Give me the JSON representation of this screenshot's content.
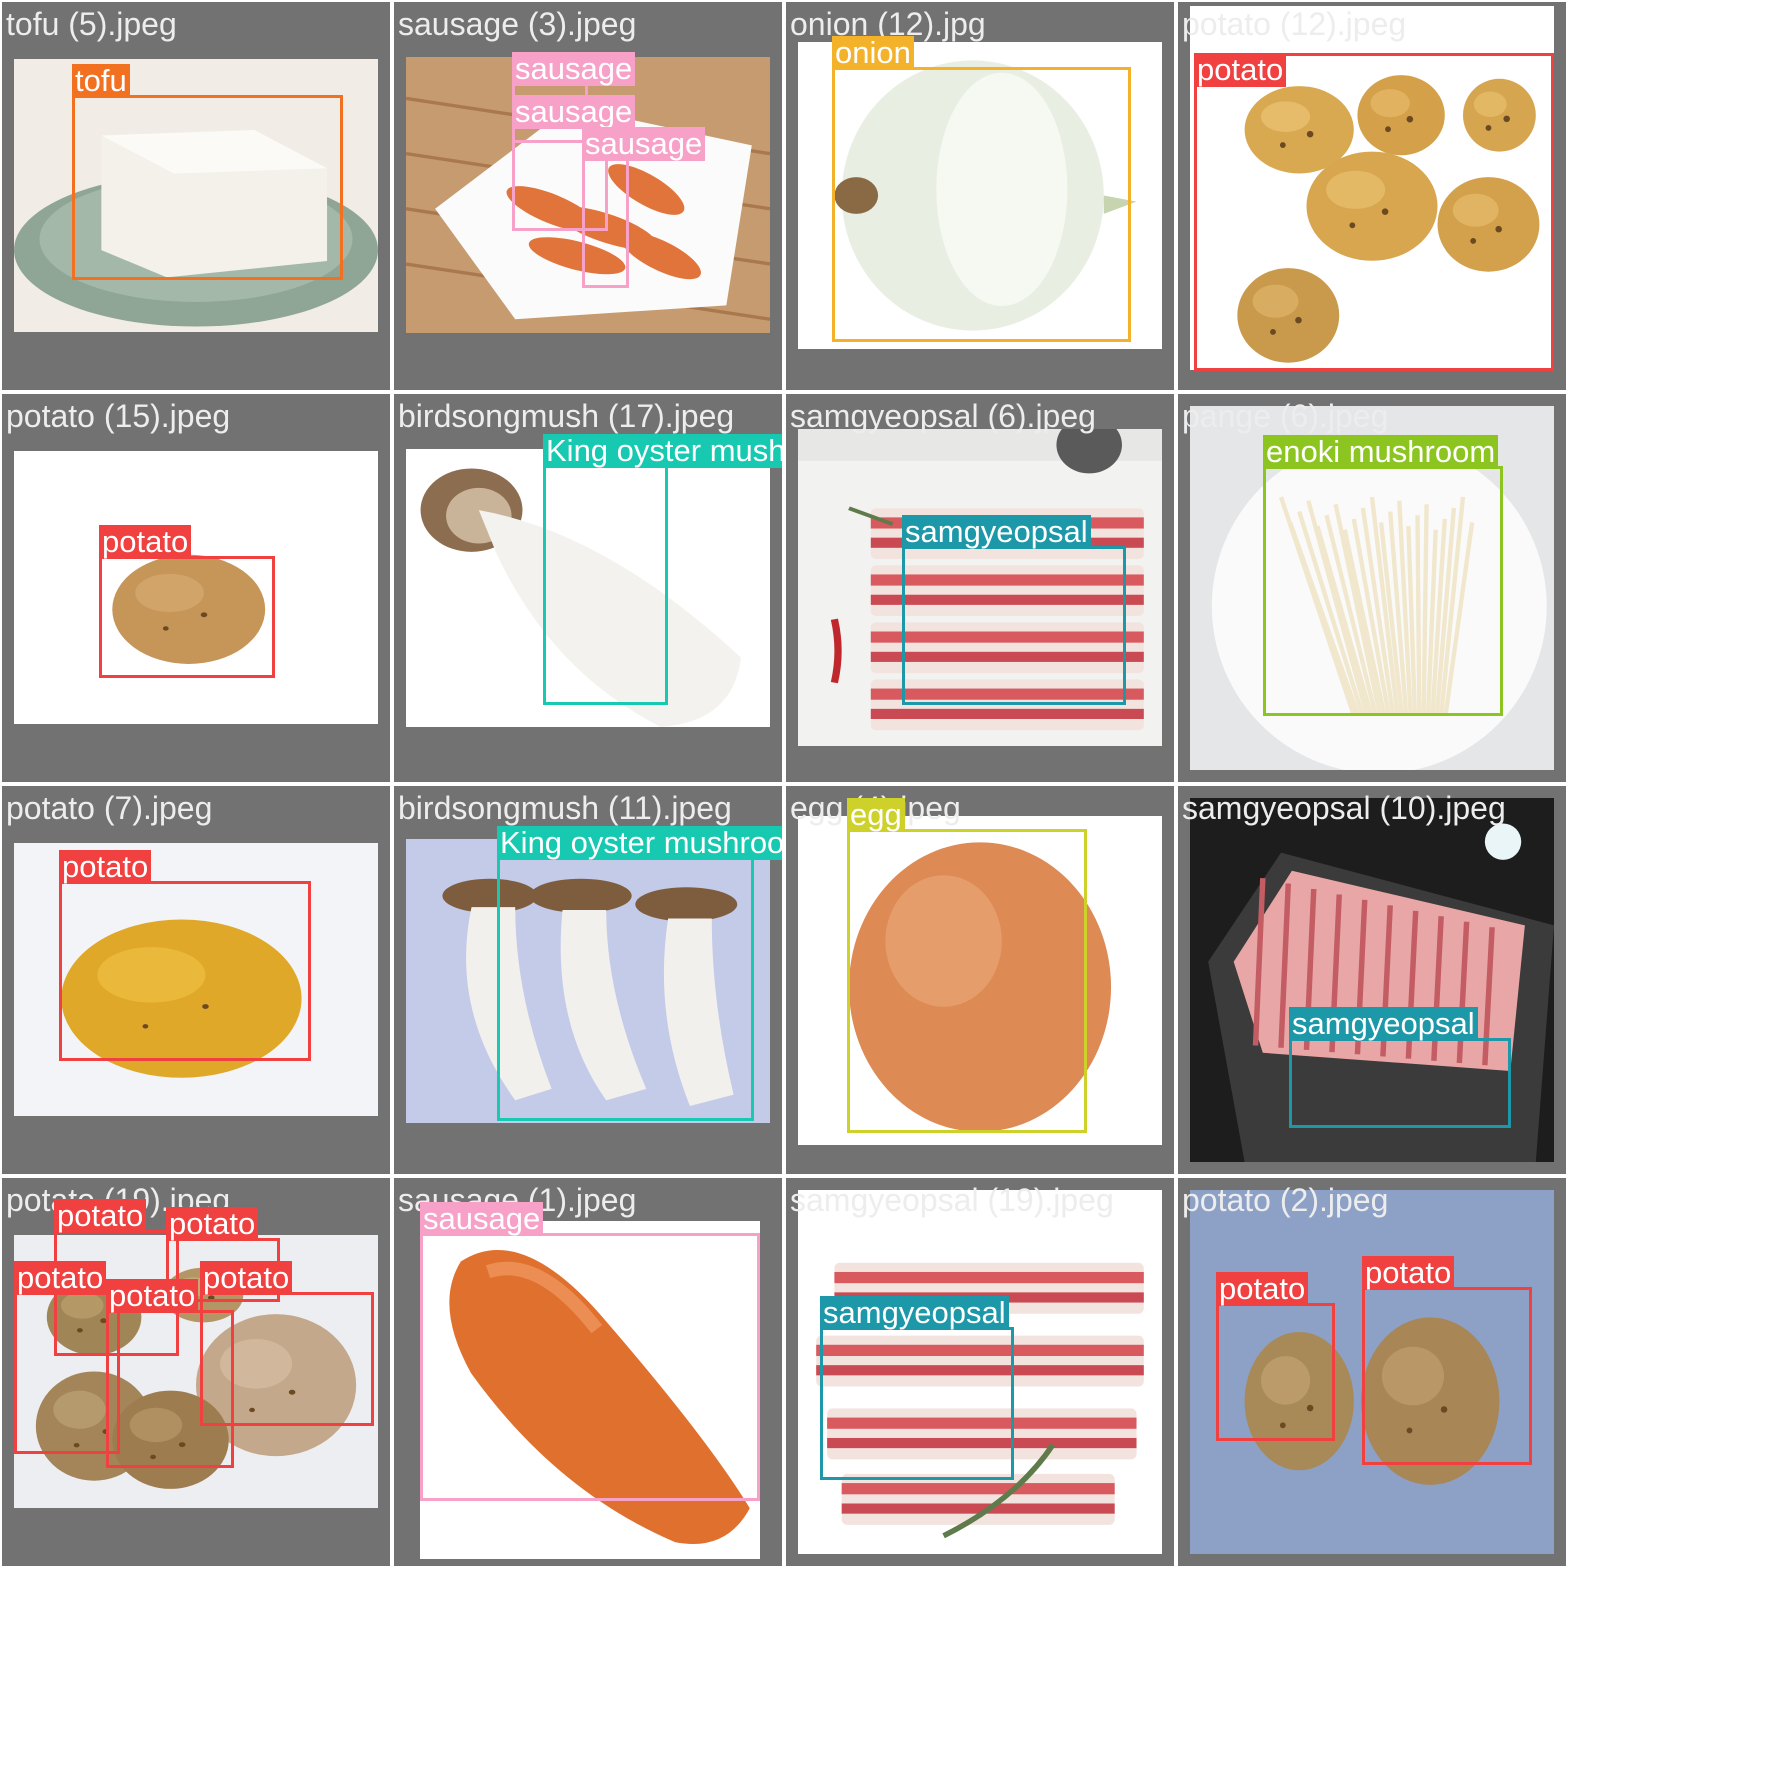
{
  "colors": {
    "tofu": "#f27121",
    "sausage": "#f7a1c8",
    "onion": "#f3b229",
    "potato": "#f04040",
    "king_oyster": "#17c9b0",
    "samgyeopsal": "#1d98a8",
    "enoki": "#8cc51f",
    "egg": "#cdd12a",
    "cell_bg": "#727272"
  },
  "cells": [
    {
      "title": "tofu (5).jpeg",
      "image": "tofu-image",
      "detections": [
        {
          "label": "tofu",
          "class": "tofu"
        }
      ]
    },
    {
      "title": "sausage (3).jpeg",
      "image": "sausage-plate-image",
      "detections": [
        {
          "label": "sausage",
          "class": "sausage"
        },
        {
          "label": "sausage",
          "class": "sausage"
        },
        {
          "label": "sausage",
          "class": "sausage"
        }
      ]
    },
    {
      "title": "onion (12).jpg",
      "image": "onion-image",
      "detections": [
        {
          "label": "onion",
          "class": "onion"
        }
      ]
    },
    {
      "title": "potato (12).jpeg",
      "image": "potatoes-pile-image",
      "detections": [
        {
          "label": "potato",
          "class": "potato"
        }
      ]
    },
    {
      "title": "potato (15).jpeg",
      "image": "single-potato-image",
      "detections": [
        {
          "label": "potato",
          "class": "potato"
        }
      ]
    },
    {
      "title": "birdsongmush (17).jpeg",
      "image": "king-oyster-mushroom-image",
      "detections": [
        {
          "label": "King oyster mushroom",
          "class": "king_oyster"
        }
      ]
    },
    {
      "title": "samgyeopsal (6).jpeg",
      "image": "pork-belly-tray-image",
      "detections": [
        {
          "label": "samgyeopsal",
          "class": "samgyeopsal"
        }
      ]
    },
    {
      "title": "pange (6).jpeg",
      "image": "enoki-mushroom-image",
      "detections": [
        {
          "label": "enoki mushroom",
          "class": "enoki"
        }
      ]
    },
    {
      "title": "potato (7).jpeg",
      "image": "yellow-potato-image",
      "detections": [
        {
          "label": "potato",
          "class": "potato"
        }
      ]
    },
    {
      "title": "birdsongmush (11).jpeg",
      "image": "three-mushrooms-image",
      "detections": [
        {
          "label": "King oyster mushroom",
          "class": "king_oyster"
        }
      ]
    },
    {
      "title": "egg (4).jpeg",
      "image": "egg-image",
      "detections": [
        {
          "label": "egg",
          "class": "egg"
        }
      ]
    },
    {
      "title": "samgyeopsal (10).jpeg",
      "image": "pork-belly-slate-image",
      "detections": [
        {
          "label": "samgyeopsal",
          "class": "samgyeopsal"
        }
      ]
    },
    {
      "title": "potato (19).jpeg",
      "image": "dirty-potatoes-image",
      "detections": [
        {
          "label": "potato",
          "class": "potato"
        },
        {
          "label": "potato",
          "class": "potato"
        },
        {
          "label": "potato",
          "class": "potato"
        },
        {
          "label": "potato",
          "class": "potato"
        },
        {
          "label": "potato",
          "class": "potato"
        }
      ]
    },
    {
      "title": "sausage (1).jpeg",
      "image": "large-sausage-image",
      "detections": [
        {
          "label": "sausage",
          "class": "sausage"
        }
      ]
    },
    {
      "title": "samgyeopsal (19).jpeg",
      "image": "pork-belly-rosemary-image",
      "detections": [
        {
          "label": "samgyeopsal",
          "class": "samgyeopsal"
        }
      ]
    },
    {
      "title": "potato (2).jpeg",
      "image": "two-potatoes-image",
      "detections": [
        {
          "label": "potato",
          "class": "potato"
        },
        {
          "label": "potato",
          "class": "potato"
        }
      ]
    }
  ]
}
